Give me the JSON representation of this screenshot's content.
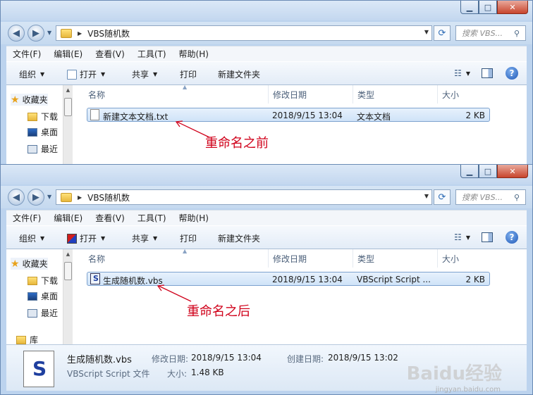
{
  "window_top": {
    "address": {
      "path": "VBS随机数",
      "search_placeholder": "搜索 VBS..."
    },
    "menu": [
      "文件(F)",
      "编辑(E)",
      "查看(V)",
      "工具(T)",
      "帮助(H)"
    ],
    "toolbar": {
      "organize": "组织",
      "open": "打开",
      "share": "共享",
      "print": "打印",
      "new_folder": "新建文件夹"
    },
    "nav": {
      "favorites": "收藏夹",
      "downloads": "下载",
      "desktop": "桌面",
      "recent": "最近"
    },
    "columns": {
      "name": "名称",
      "modified": "修改日期",
      "type": "类型",
      "size": "大小"
    },
    "file": {
      "name": "新建文本文档.txt",
      "modified": "2018/9/15 13:04",
      "type": "文本文档",
      "size": "2 KB"
    },
    "annotation": "重命名之前"
  },
  "window_bottom": {
    "address": {
      "path": "VBS随机数",
      "search_placeholder": "搜索 VBS..."
    },
    "menu": [
      "文件(F)",
      "编辑(E)",
      "查看(V)",
      "工具(T)",
      "帮助(H)"
    ],
    "toolbar": {
      "organize": "组织",
      "open": "打开",
      "share": "共享",
      "print": "打印",
      "new_folder": "新建文件夹"
    },
    "nav": {
      "favorites": "收藏夹",
      "downloads": "下载",
      "desktop": "桌面",
      "recent": "最近",
      "library": "库"
    },
    "columns": {
      "name": "名称",
      "modified": "修改日期",
      "type": "类型",
      "size": "大小"
    },
    "file": {
      "name": "生成随机数.vbs",
      "modified": "2018/9/15 13:04",
      "type": "VBScript Script ...",
      "size": "2 KB"
    },
    "annotation": "重命名之后",
    "details": {
      "name": "生成随机数.vbs",
      "type": "VBScript Script 文件",
      "modified_label": "修改日期:",
      "modified_value": "2018/9/15 13:04",
      "created_label": "创建日期:",
      "created_value": "2018/9/15 13:02",
      "size_label": "大小:",
      "size_value": "1.48 KB"
    }
  },
  "watermark": {
    "main": "Baidu经验",
    "sub": "jingyan.baidu.com"
  },
  "colors": {
    "annotation": "#d0021b",
    "selection": "#cfe3f8",
    "chrome": "#bcd3ee"
  }
}
